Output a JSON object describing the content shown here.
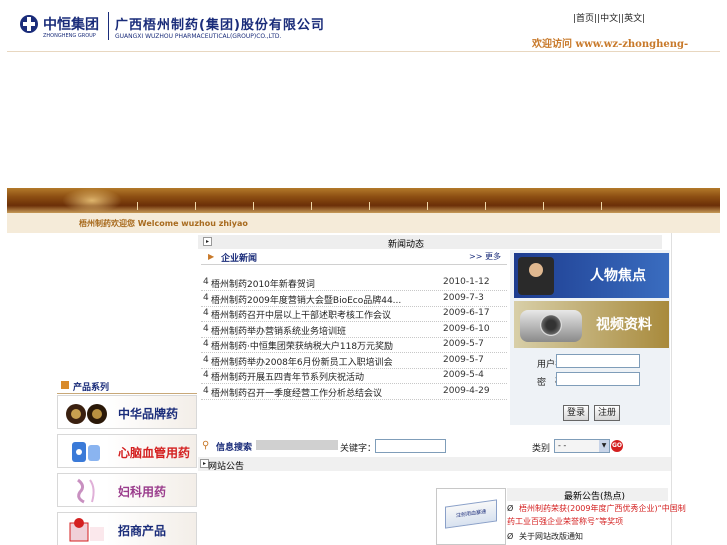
{
  "header": {
    "group_cn": "中恒集团",
    "group_en": "ZHONGHENG GROUP",
    "company_cn": "广西梧州制药(集团)股份有限公司",
    "company_en": "GUANGXI WUZHOU PHARMACEUTICAL(GROUP)CO.,LTD.",
    "top_links": "|首页||中文||英文|",
    "welcome_url": "欢迎访问 www.wz-zhongheng-zy.com"
  },
  "subbar": {
    "welcome": "梧州制药欢迎您  Welcome wuzhou zhiyao"
  },
  "news_section": {
    "title": "新闻动态",
    "corp_news_label": "企业新闻",
    "more_label": ">> 更多",
    "bullet": "4",
    "items": [
      {
        "title": "梧州制药2010年新春贺词",
        "date": "2010-1-12"
      },
      {
        "title": "梧州制药2009年度营销大会暨BioEco品牌44...",
        "date": "2009-7-3"
      },
      {
        "title": "梧州制药召开中层以上干部述职考核工作会议",
        "date": "2009-6-17"
      },
      {
        "title": "梧州制药举办营销系统业务培训班",
        "date": "2009-6-10"
      },
      {
        "title": "梧州制药·中恒集团荣获纳税大户118万元奖励",
        "date": "2009-5-7"
      },
      {
        "title": "梧州制药举办2008年6月份新员工入职培训会",
        "date": "2009-5-7"
      },
      {
        "title": "梧州制药开展五四青年节系列庆祝活动",
        "date": "2009-5-4"
      },
      {
        "title": "梧州制药召开一季度经营工作分析总结会议",
        "date": "2009-4-29"
      }
    ]
  },
  "sidebar_promos": {
    "people_focus": "人物焦点",
    "video_data": "视频资料"
  },
  "login": {
    "user_label": "用户名",
    "pass_label": "密　码",
    "login_button": "登录",
    "register_button": "注册"
  },
  "product_series": {
    "title": "产品系列",
    "categories": [
      {
        "label": "中华品牌药",
        "color": "#1a2c7a"
      },
      {
        "label": "心脑血管用药",
        "color": "#d42020"
      },
      {
        "label": "妇科用药",
        "color": "#9a3c8c"
      },
      {
        "label": "招商产品",
        "color": "#1a2c7a"
      }
    ]
  },
  "info_search": {
    "title": "信息搜索",
    "keyword_label": "关键字：",
    "type_label": "类别",
    "type_value": "- -",
    "go_label": "GO"
  },
  "announcement": {
    "title": "网站公告",
    "product_name": "注射用血塞通",
    "notice_title": "最新公告(热点)",
    "bullet_symbol": "Ø",
    "notices": [
      {
        "text": "梧州制药荣获(2009年度广西优秀企业)“中国制",
        "color": "#d42020"
      },
      {
        "text": "药工业百强企业荣誉称号”等奖项",
        "color": "#d42020"
      },
      {
        "text": "关于网站改版通知",
        "color": "#222222"
      }
    ]
  }
}
